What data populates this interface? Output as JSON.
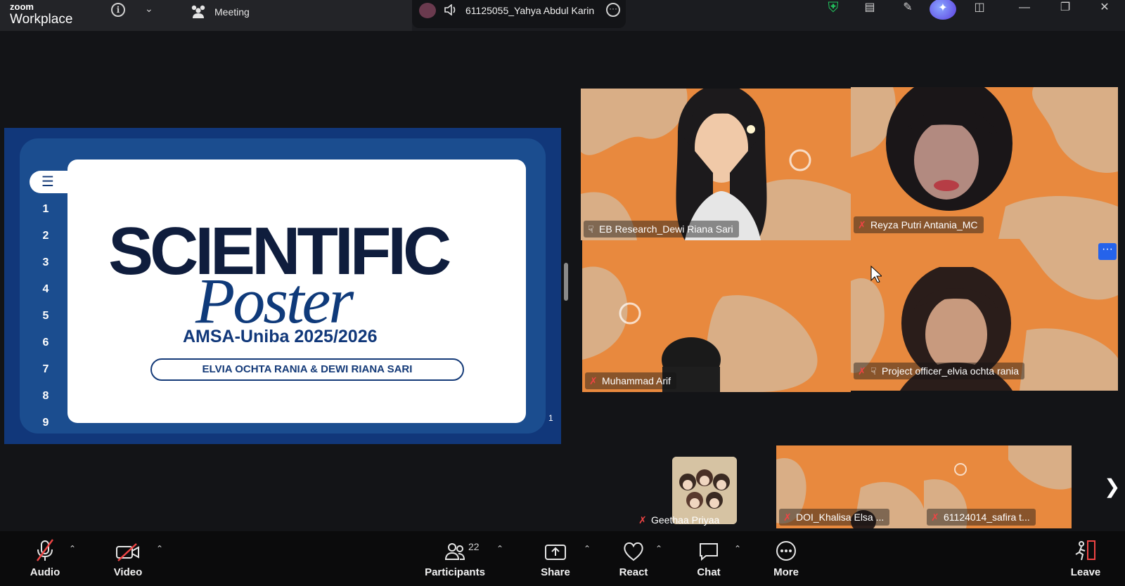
{
  "app": {
    "brand_small": "zoom",
    "brand_large": "Workplace",
    "meeting_label": "Meeting"
  },
  "active_speaker": {
    "name": "61125055_Yahya Abdul Karin"
  },
  "icons": {
    "info": "info-icon",
    "chevron": "chevron-down-icon",
    "meeting": "people-icon",
    "speaker": "speaker-icon",
    "more": "more-options-icon",
    "shield": "shield-check-icon",
    "notes": "notes-icon",
    "pen": "annotate-pen-icon",
    "ai": "ai-companion-icon",
    "panel": "side-panel-icon",
    "minimize": "minimize-icon",
    "maximize": "restore-window-icon",
    "close": "close-icon"
  },
  "slide": {
    "title_line1": "SCIENTIFIC",
    "title_line2": "Poster",
    "subtitle": "AMSA-Uniba 2025/2026",
    "authors": "ELVIA OCHTA RANIA & DEWI RIANA SARI",
    "page_indicator": "1",
    "page_list": [
      "1",
      "2",
      "3",
      "4",
      "5",
      "6",
      "7",
      "8",
      "9"
    ],
    "menu_icon": "hamburger-menu-icon"
  },
  "tiles": [
    {
      "name": "EB Research_Dewi Riana Sari",
      "pinned": true,
      "muted": false,
      "active": true
    },
    {
      "name": "Reyza Putri Antania_MC",
      "pinned": false,
      "muted": true,
      "active": false
    },
    {
      "name": "Muhammad Arif",
      "pinned": false,
      "muted": true,
      "active": false
    },
    {
      "name": "Project officer_elvia ochta rania",
      "pinned": true,
      "muted": true,
      "active": false
    }
  ],
  "thumbnails": [
    {
      "name": "Geethaa Priyaa",
      "muted": true
    },
    {
      "name": "DOI_Khalisa Elsa ...",
      "muted": true
    },
    {
      "name": "61124014_safira t...",
      "muted": true
    }
  ],
  "toolbar": {
    "audio": "Audio",
    "video": "Video",
    "participants": "Participants",
    "participants_count": "22",
    "share": "Share",
    "react": "React",
    "chat": "Chat",
    "more": "More",
    "leave": "Leave"
  },
  "colors": {
    "tile_orange": "#e8893e",
    "tile_tan": "#d9ae86",
    "active_border": "#4ade80",
    "mic_off": "#ef4444",
    "slide_navy": "#0f1d3d",
    "slide_blue": "#11387a"
  }
}
